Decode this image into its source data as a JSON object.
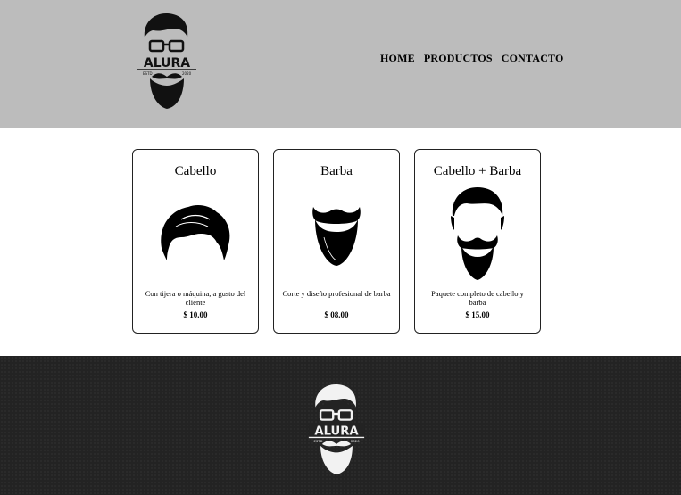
{
  "brand": {
    "name": "ALURA",
    "estd": "ESTD",
    "year": "2020"
  },
  "nav": {
    "items": [
      {
        "label": "HOME"
      },
      {
        "label": "PRODUCTOS"
      },
      {
        "label": "CONTACTO"
      }
    ]
  },
  "products": [
    {
      "title": "Cabello",
      "description": "Con tijera o máquina, a gusto del cliente",
      "price": "$ 10.00",
      "image": "hair-icon"
    },
    {
      "title": "Barba",
      "description": "Corte y diseño profesional de barba",
      "price": "$ 08.00",
      "image": "beard-icon"
    },
    {
      "title": "Cabello + Barba",
      "description": "Paquete completo de cabello y barba",
      "price": "$ 15.00",
      "image": "hair-and-beard-icon"
    }
  ],
  "colors": {
    "header_bg": "#bcbcbc",
    "footer_bg": "#232323",
    "card_border": "#222222"
  }
}
